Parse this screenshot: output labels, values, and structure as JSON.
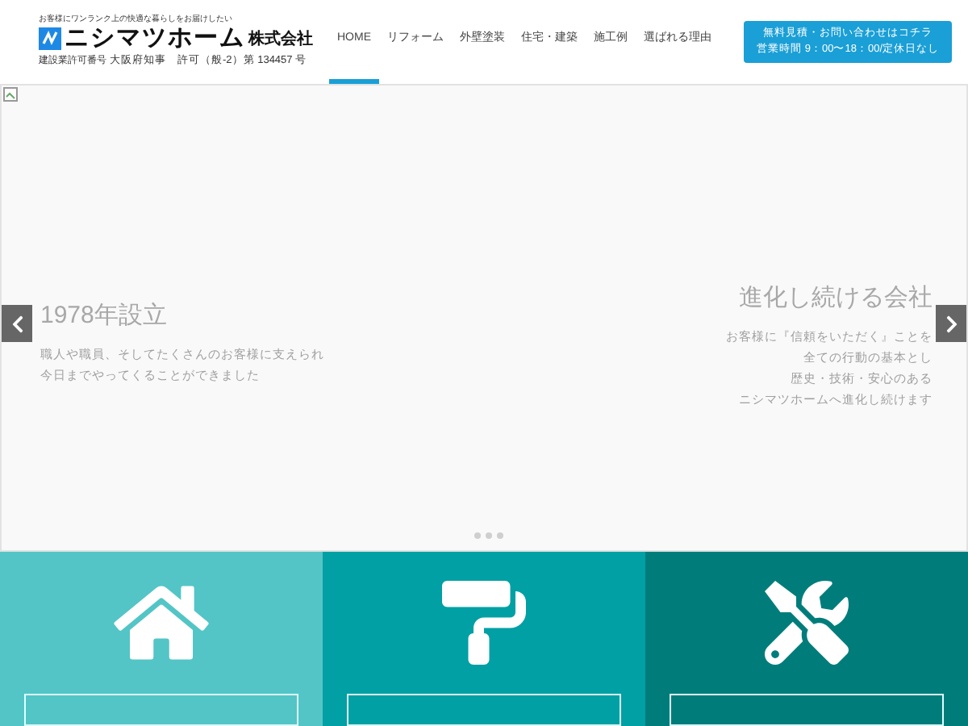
{
  "header": {
    "tagline": "お客様にワンランク上の快適な暮らしをお届けしたい",
    "company_name": "ニシマツホーム",
    "company_suffix": "株式会社",
    "license_label": "建設業許可番号",
    "license": "大阪府知事　許可（般-2）第 134457 号"
  },
  "nav": [
    {
      "label": "HOME",
      "selected": true
    },
    {
      "label": "リフォーム",
      "selected": false
    },
    {
      "label": "外壁塗装",
      "selected": false
    },
    {
      "label": "住宅・建築",
      "selected": false
    },
    {
      "label": "施工例",
      "selected": false
    },
    {
      "label": "選ばれる理由",
      "selected": false
    }
  ],
  "cta": {
    "line_1": "無料見積・お問い合わせはコチラ",
    "line_2": "営業時間 9：00〜18：00/定休日なし"
  },
  "slides": [
    {
      "title": "1978年設立",
      "lines": [
        "職人や職員、そしてたくさんのお客様に支えられ",
        "今日までやってくることができました"
      ]
    },
    {
      "title": "進化し続ける会社",
      "lines": [
        "お客様に『信頼をいただく』ことを",
        "全ての行動の基本とし",
        "歴史・技術・安心のある",
        "ニシマツホームへ進化し続けます"
      ]
    }
  ],
  "services": [
    {
      "kind": "house",
      "color": "#53c5c6"
    },
    {
      "kind": "roller",
      "color": "#00a0a4"
    },
    {
      "kind": "tools",
      "color": "#007d7b"
    }
  ]
}
